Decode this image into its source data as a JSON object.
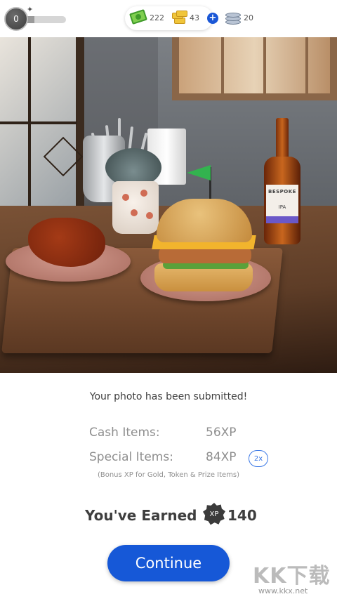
{
  "hud": {
    "level": "0",
    "level_progress": 0.35,
    "cash": "222",
    "gold": "43",
    "add_label": "+",
    "tokens": "20"
  },
  "photo": {
    "bottle_brand": "BESPOKE",
    "bottle_type": "IPA"
  },
  "results": {
    "submitted_text": "Your photo has been submitted!",
    "cash_items_label": "Cash Items:",
    "cash_items_xp": "56XP",
    "special_items_label": "Special Items:",
    "special_items_xp": "84XP",
    "multiplier": "2x",
    "bonus_note": "(Bonus XP for Gold, Token & Prize Items)",
    "earned_label": "You've Earned",
    "xp_badge": "XP",
    "earned_value": "140"
  },
  "continue_label": "Continue",
  "watermark": {
    "big": "KK下载",
    "small": "www.kkx.net"
  },
  "colors": {
    "primary_blue": "#1658d7",
    "cash_green": "#7fcf4f",
    "gold": "#f0c53a"
  }
}
